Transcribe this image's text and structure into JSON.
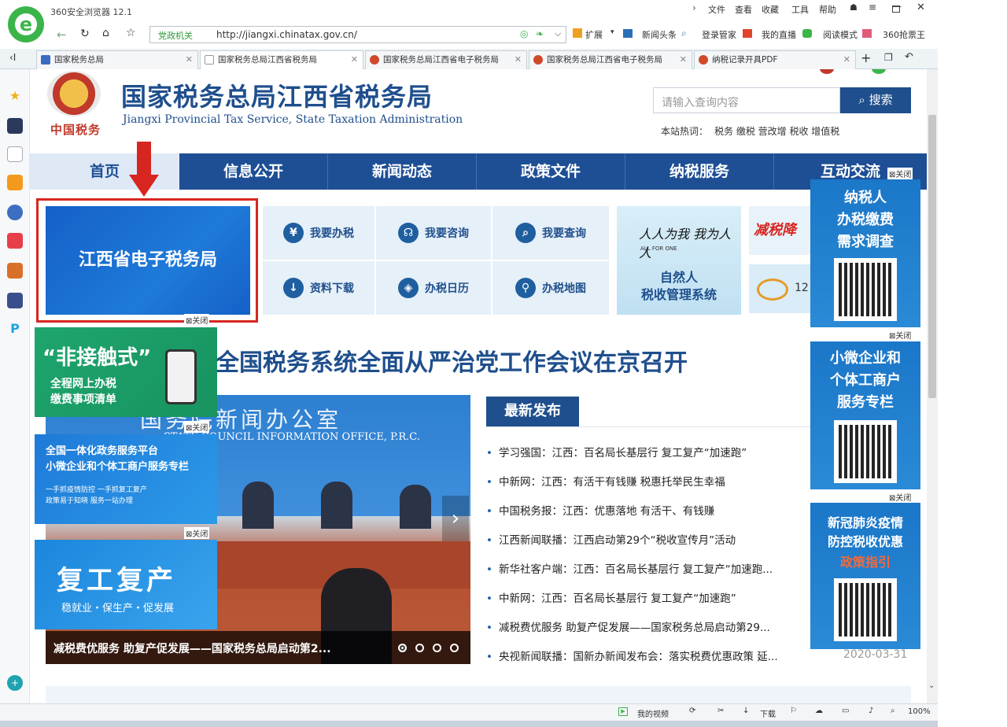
{
  "browser": {
    "title": "360安全浏览器 12.1",
    "menu": [
      "文件",
      "查看",
      "收藏",
      "工具",
      "帮助"
    ],
    "address_tag": "党政机关",
    "url": "http://jiangxi.chinatax.gov.cn/",
    "toolbar_items": [
      "扩展",
      "新闻头条",
      "登录管家",
      "我的直播",
      "阅读模式",
      "360抢票王"
    ],
    "tabs": [
      {
        "label": "国家税务总局",
        "active": false
      },
      {
        "label": "国家税务总局江西省税务局",
        "active": true
      },
      {
        "label": "国家税务总局江西省电子税务局",
        "active": false
      },
      {
        "label": "国家税务总局江西省电子税务局",
        "active": false
      },
      {
        "label": "纳税记录开具PDF",
        "active": false
      }
    ],
    "status": {
      "video": "我的视频",
      "download": "下载",
      "zoom": "100%"
    }
  },
  "site": {
    "title_cn": "国家税务总局江西省税务局",
    "title_en": "Jiangxi Provincial Tax Service, State Taxation Administration",
    "logo_caption": "中国税务",
    "search_placeholder": "请输入查询内容",
    "search_button": "搜索",
    "hot_label": "本站热词：",
    "hot_words": "税务 缴税 营改增 税收 增值税"
  },
  "nav": [
    "首页",
    "信息公开",
    "新闻动态",
    "政策文件",
    "纳税服务",
    "互动交流"
  ],
  "etax_banner": "江西省电子税务局",
  "services": [
    {
      "label": "我要办税",
      "icon": "hand-coin-icon"
    },
    {
      "label": "我要咨询",
      "icon": "headset-icon"
    },
    {
      "label": "我要查询",
      "icon": "search-doc-icon"
    },
    {
      "label": "资料下载",
      "icon": "download-icon"
    },
    {
      "label": "办税日历",
      "icon": "compass-icon"
    },
    {
      "label": "办税地图",
      "icon": "map-pin-icon"
    }
  ],
  "promo_natural": {
    "slogan": "人人为我 我为人人",
    "slogan_small": "ALL FOR ONE",
    "title": "自然人\n税收管理系统"
  },
  "promo_small": {
    "text1": "减税降",
    "text2": "12"
  },
  "headline": "全国税务系统全面从严治党工作会议在京召开",
  "latest_label": "最新发布",
  "news": [
    "学习强国：江西：百名局长基层行 复工复产“加速跑”",
    "中新网：江西：有活干有钱赚 税惠托举民生幸福",
    "中国税务报：江西：优惠落地 有活干、有钱赚",
    "江西新闻联播：江西启动第29个“税收宣传月”活动",
    "新华社客户端：江西：百名局长基层行 复工复产“加速跑...",
    "中新网：江西：百名局长基层行 复工复产“加速跑”",
    "减税费优服务 助复产促发展——国家税务总局启动第29...",
    "央视新闻联播：国新办新闻发布会：落实税费优惠政策 延..."
  ],
  "news_date": "2020-03-31",
  "slide": {
    "caption": "减税费优服务 助复产促发展——国家税务总局启动第2...",
    "backdrop_cn": "国务院新闻办公室",
    "backdrop_en": "STATE COUNCIL INFORMATION OFFICE, P.R.C.",
    "dots": 4,
    "active_dot": 1
  },
  "close_label": "关闭",
  "float_left": [
    {
      "title": "“非接触式”",
      "sub": "全程网上办税\n缴费事项清单"
    },
    {
      "title": "全国一体化政务服务平台\n小微企业和个体工商户服务专栏",
      "sub": "一手抓疫情防控 一手抓复工复产\n政策易于知晓 服务一站办理"
    },
    {
      "title": "复工复产",
      "sub": "稳就业・保生产・促发展"
    }
  ],
  "float_right": [
    {
      "title": "纳税人\n办税缴费\n需求调查"
    },
    {
      "title": "小微企业和\n个体工商户\n服务专栏"
    },
    {
      "title": "新冠肺炎疫情\n防控税收优惠",
      "highlight": "政策指引"
    }
  ],
  "colors": {
    "nav": "#1e4f95",
    "brand": "#1d5aa5",
    "annot_red": "#d7261f"
  }
}
